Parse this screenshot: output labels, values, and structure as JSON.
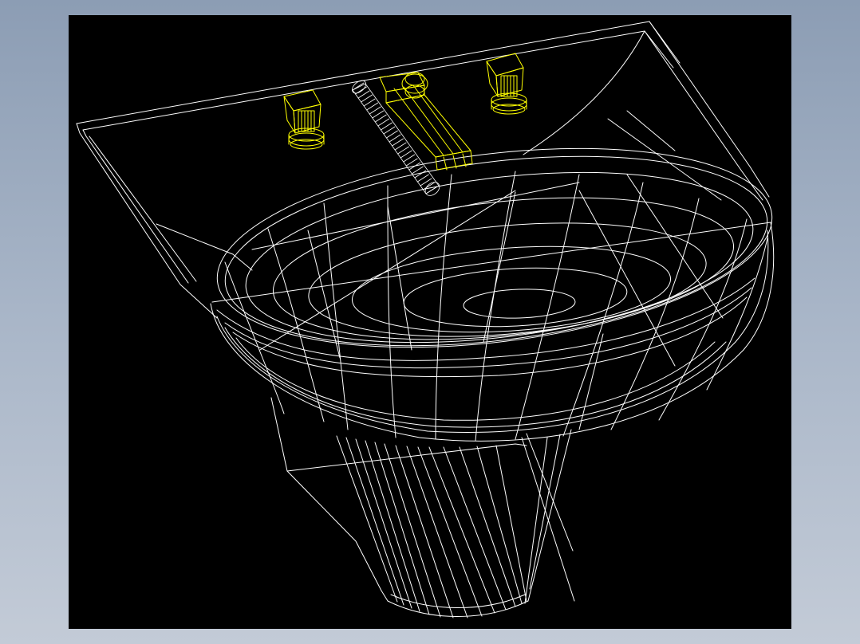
{
  "viewport": {
    "background": "#000000",
    "frame_color": "#8c9db4"
  },
  "model": {
    "washbasin_color": "#ffffff",
    "fixtures_color": "#ffff00"
  }
}
